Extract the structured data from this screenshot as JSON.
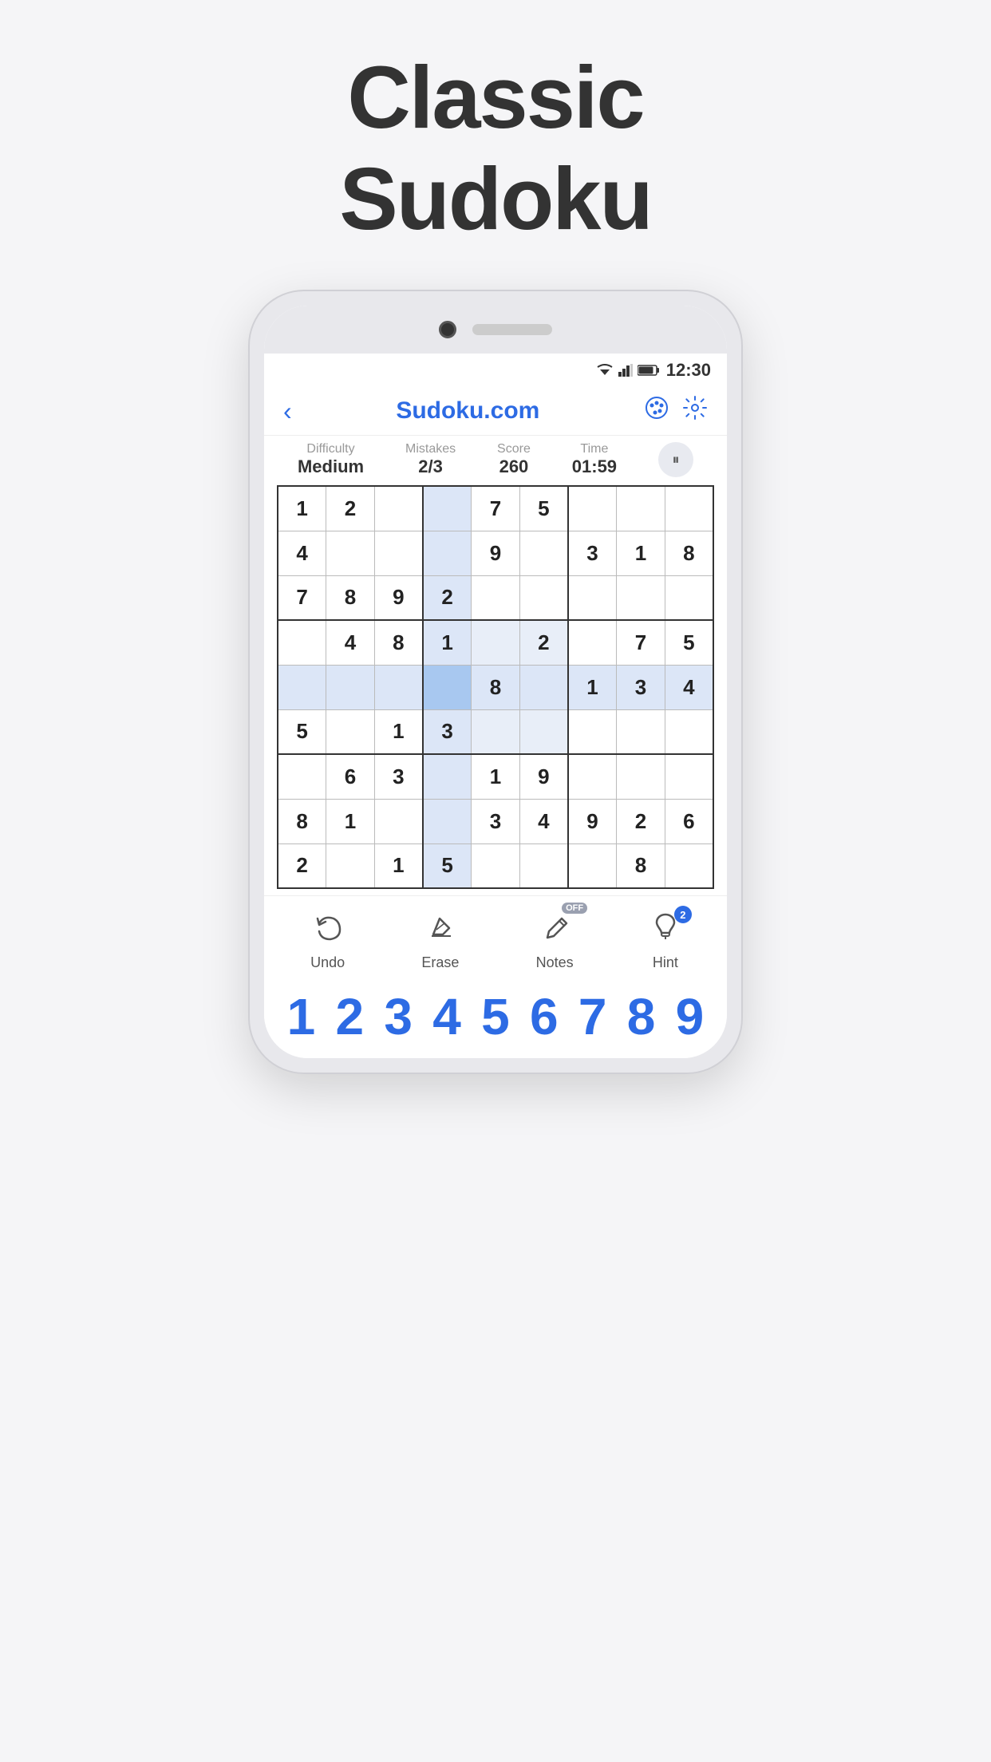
{
  "page": {
    "title_line1": "Classic",
    "title_line2": "Sudoku"
  },
  "status_bar": {
    "time": "12:30"
  },
  "header": {
    "back_label": "‹",
    "title": "Sudoku.com",
    "palette_icon": "🎨",
    "settings_icon": "⚙"
  },
  "stats": {
    "difficulty_label": "Difficulty",
    "difficulty_value": "Medium",
    "mistakes_label": "Mistakes",
    "mistakes_value": "2/3",
    "score_label": "Score",
    "score_value": "260",
    "time_label": "Time",
    "time_value": "01:59"
  },
  "grid": {
    "rows": [
      [
        "1",
        "2",
        "",
        "",
        "7",
        "5",
        "",
        "",
        ""
      ],
      [
        "4",
        "",
        "",
        "",
        "9",
        "",
        "3",
        "1",
        "8"
      ],
      [
        "7",
        "8",
        "9",
        "2",
        "",
        "",
        "",
        "",
        ""
      ],
      [
        "",
        "4",
        "8",
        "1",
        "",
        "2",
        "",
        "7",
        "5"
      ],
      [
        "",
        "",
        "",
        "",
        "8",
        "",
        "1",
        "3",
        "4"
      ],
      [
        "5",
        "",
        "1",
        "3",
        "",
        "",
        "",
        "",
        ""
      ],
      [
        "",
        "6",
        "3",
        "",
        "1",
        "9",
        "",
        "",
        ""
      ],
      [
        "8",
        "1",
        "",
        "",
        "3",
        "4",
        "9",
        "2",
        "6"
      ],
      [
        "2",
        "",
        "1",
        "5",
        "",
        "",
        "",
        "8",
        ""
      ]
    ],
    "highlight": {
      "selected_cell": [
        4,
        3
      ],
      "col": 3,
      "row": 4
    }
  },
  "toolbar": {
    "undo_label": "Undo",
    "erase_label": "Erase",
    "notes_label": "Notes",
    "notes_badge": "OFF",
    "hint_label": "Hint",
    "hint_badge": "2"
  },
  "numpad": {
    "numbers": [
      "1",
      "2",
      "3",
      "4",
      "5",
      "6",
      "7",
      "8",
      "9"
    ]
  }
}
